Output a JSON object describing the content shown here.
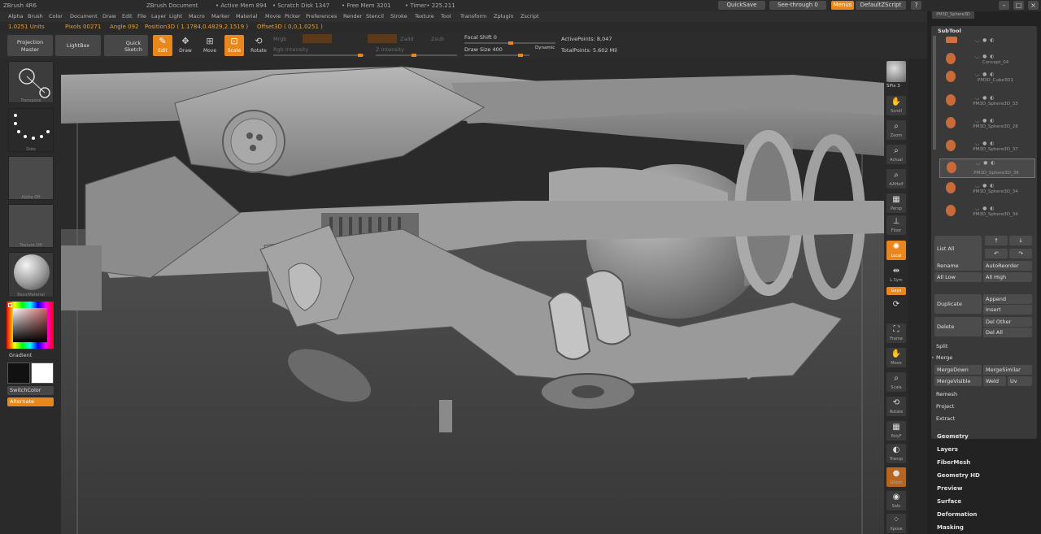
{
  "titlebar": {
    "app": "ZBrush 4R6",
    "doc": "ZBrush Document",
    "active_mem": "• Active Mem 894",
    "scratch": "• Scratch Disk 1347",
    "free_mem": "• Free Mem 3201",
    "timer": "• Timer• 225.211",
    "quicksave": "QuickSave",
    "seethrough": "See-through 0",
    "menus": "Menus",
    "script": "DefaultZScript"
  },
  "menubar": [
    "Alpha",
    "Brush",
    "Color",
    "Document",
    "Draw",
    "Edit",
    "File",
    "Layer",
    "Light",
    "Macro",
    "Marker",
    "Material",
    "Movie",
    "Picker",
    "Preferences",
    "Render",
    "Stencil",
    "Stroke",
    "Texture",
    "Tool",
    "Transform",
    "Zplugin",
    "Zscript"
  ],
  "infoline": {
    "units": "1.0251 Units",
    "pixols": "Pixols 00271",
    "angle": "Angle 092",
    "position": "Position3D ( 1.1784,0.4829,2.1519 )",
    "offset": "Offset3D ( 0,0,1.0251 )"
  },
  "shelf": {
    "projection_master": "Projection Master",
    "lightbox": "LightBox",
    "quick_sketch": "Quick Sketch",
    "edit": "Edit",
    "draw": "Draw",
    "move": "Move",
    "scale": "Scale",
    "rotate": "Rotate",
    "mrgb": "Mrgb",
    "rgb_intensity": "Rgb Intensity",
    "zadd": "Zadd",
    "zsub": "Zsub",
    "z_intensity": "Z Intensity",
    "focal_shift": "Focal Shift 0",
    "draw_size": "Draw Size 400",
    "dynamic": "Dynamic",
    "active_points": "ActivePoints: 8,047",
    "total_points": "TotalPoints: 5.602 Mil"
  },
  "lefttray": {
    "transpose": "Transpose",
    "dots": "Dots",
    "alpha_off": "Alpha Off",
    "texture_off": "Texture Off",
    "basic_material": "BasicMaterial",
    "gradient": "Gradient",
    "switch_color": "SwitchColor",
    "alternate": "Alternate",
    "colors": {
      "accent": "#e8871e",
      "main": "#111111",
      "secondary": "#ffffff"
    }
  },
  "rightshelf": {
    "spix": "SPix 3",
    "scroll": "Scroll",
    "zoom": "Zoom",
    "actual": "Actual",
    "aahalf": "AAHalf",
    "persp": "Persp",
    "floor": "Floor",
    "local": "Local",
    "lsym": "L.Sym",
    "xyz": "Gxyz",
    "frame": "Frame",
    "move": "Move",
    "scale": "Scale",
    "rotate": "Rotate",
    "polyf": "PolyF",
    "transp": "Transp",
    "ghost": "Ghost",
    "solo": "Solo",
    "xpose": "Xpose"
  },
  "rightpanel": {
    "top_label": "PM3D_Sphere3D",
    "subtool_title": "SubTool",
    "subtools": [
      {
        "name": "",
        "icon_color": "#c86a3a"
      },
      {
        "name": "Concept_04",
        "icon_color": "#c86a3a"
      },
      {
        "name": "PM3D_Cube3D1",
        "icon_color": "#c86a3a"
      },
      {
        "name": "PM3D_Sphere3D_33",
        "icon_color": "#c86a3a"
      },
      {
        "name": "PM3D_Sphere3D_28",
        "icon_color": "#c86a3a"
      },
      {
        "name": "PM3D_Sphere3D_37",
        "icon_color": "#c86a3a"
      },
      {
        "name": "PM3D_Sphere3D_36",
        "icon_color": "#c86a3a"
      },
      {
        "name": "PM3D_Sphere3D_34",
        "icon_color": "#c86a3a"
      },
      {
        "name": "PM3D_Sphere3D_34",
        "icon_color": "#c86a3a"
      }
    ],
    "list_all": "List All",
    "rename": "Rename",
    "autoreorder": "AutoReorder",
    "all_low": "All Low",
    "all_high": "All High",
    "duplicate": "Duplicate",
    "append": "Append",
    "insert": "Insert",
    "delete": "Delete",
    "del_other": "Del Other",
    "del_all": "Del All",
    "split": "Split",
    "merge": "Merge",
    "merge_down": "MergeDown",
    "merge_similar": "MergeSimilar",
    "merge_visible": "MergeVisible",
    "weld": "Weld",
    "uv": "Uv",
    "remesh": "Remesh",
    "project": "Project",
    "extract": "Extract",
    "menus": [
      "Geometry",
      "Layers",
      "FiberMesh",
      "Geometry HD",
      "Preview",
      "Surface",
      "Deformation",
      "Masking"
    ]
  }
}
